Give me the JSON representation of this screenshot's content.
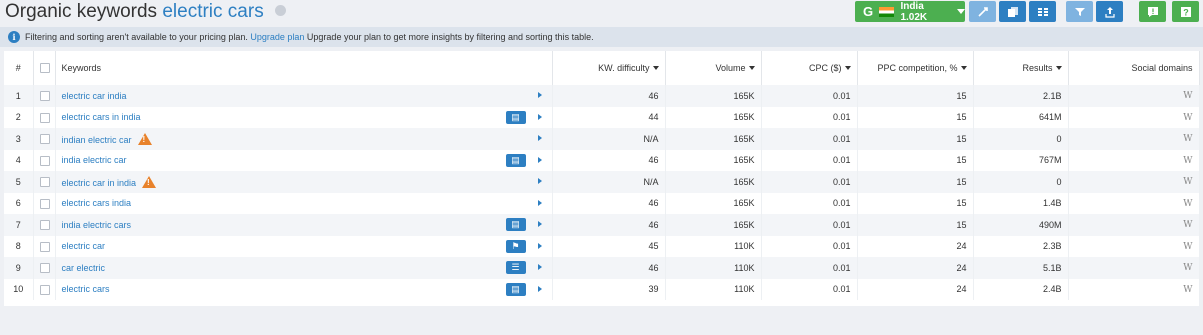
{
  "header": {
    "title_prefix": "Organic keywords",
    "title_keyword": "electric cars",
    "database_button": {
      "g": "G",
      "label": "India 1.02K"
    }
  },
  "notice": {
    "text": "Filtering and sorting aren't available to your pricing plan.",
    "link": "Upgrade plan",
    "text2": "Upgrade your plan to get more insights by filtering and sorting this table."
  },
  "table": {
    "columns": {
      "index": "#",
      "keywords": "Keywords",
      "kd": "KW. difficulty",
      "volume": "Volume",
      "cpc": "CPC ($)",
      "ppc": "PPC competition, %",
      "results": "Results",
      "social": "Social domains"
    },
    "rows": [
      {
        "n": "1",
        "keyword": "electric car india",
        "kd": "46",
        "volume": "165K",
        "cpc": "0.01",
        "ppc": "15",
        "results": "2.1B",
        "social": "W",
        "serp": null,
        "warn": false
      },
      {
        "n": "2",
        "keyword": "electric cars in india",
        "kd": "44",
        "volume": "165K",
        "cpc": "0.01",
        "ppc": "15",
        "results": "641M",
        "social": "W",
        "serp": "news",
        "warn": false
      },
      {
        "n": "3",
        "keyword": "indian electric car",
        "kd": "N/A",
        "volume": "165K",
        "cpc": "0.01",
        "ppc": "15",
        "results": "0",
        "social": "W",
        "serp": null,
        "warn": true
      },
      {
        "n": "4",
        "keyword": "india electric car",
        "kd": "46",
        "volume": "165K",
        "cpc": "0.01",
        "ppc": "15",
        "results": "767M",
        "social": "W",
        "serp": "news",
        "warn": false
      },
      {
        "n": "5",
        "keyword": "electric car in india",
        "kd": "N/A",
        "volume": "165K",
        "cpc": "0.01",
        "ppc": "15",
        "results": "0",
        "social": "W",
        "serp": null,
        "warn": true
      },
      {
        "n": "6",
        "keyword": "electric cars india",
        "kd": "46",
        "volume": "165K",
        "cpc": "0.01",
        "ppc": "15",
        "results": "1.4B",
        "social": "W",
        "serp": null,
        "warn": false
      },
      {
        "n": "7",
        "keyword": "india electric cars",
        "kd": "46",
        "volume": "165K",
        "cpc": "0.01",
        "ppc": "15",
        "results": "490M",
        "social": "W",
        "serp": "news",
        "warn": false
      },
      {
        "n": "8",
        "keyword": "electric car",
        "kd": "45",
        "volume": "110K",
        "cpc": "0.01",
        "ppc": "24",
        "results": "2.3B",
        "social": "W",
        "serp": "flag",
        "warn": false
      },
      {
        "n": "9",
        "keyword": "car electric",
        "kd": "46",
        "volume": "110K",
        "cpc": "0.01",
        "ppc": "24",
        "results": "5.1B",
        "social": "W",
        "serp": "list",
        "warn": false
      },
      {
        "n": "10",
        "keyword": "electric cars",
        "kd": "39",
        "volume": "110K",
        "cpc": "0.01",
        "ppc": "24",
        "results": "2.4B",
        "social": "W",
        "serp": "news",
        "warn": false
      }
    ]
  }
}
